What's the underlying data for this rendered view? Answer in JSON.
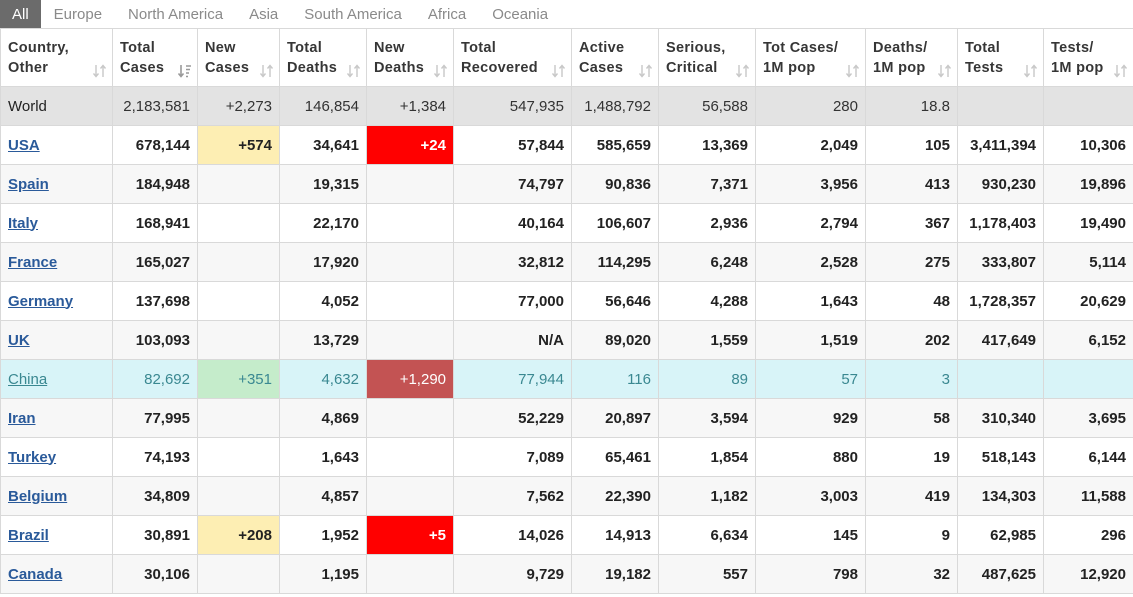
{
  "tabs": [
    "All",
    "Europe",
    "North America",
    "Asia",
    "South America",
    "Africa",
    "Oceania"
  ],
  "active_tab": "All",
  "headers": [
    [
      "Country,",
      "Other"
    ],
    [
      "Total",
      "Cases"
    ],
    [
      "New",
      "Cases"
    ],
    [
      "Total",
      "Deaths"
    ],
    [
      "New",
      "Deaths"
    ],
    [
      "Total",
      "Recovered"
    ],
    [
      "Active",
      "Cases"
    ],
    [
      "Serious,",
      "Critical"
    ],
    [
      "Tot Cases/",
      "1M pop"
    ],
    [
      "Deaths/",
      "1M pop"
    ],
    [
      "Total",
      "Tests"
    ],
    [
      "Tests/",
      "1M pop"
    ]
  ],
  "sorted_column": 1,
  "rows": [
    {
      "type": "world",
      "cells": [
        "World",
        "2,183,581",
        "+2,273",
        "146,854",
        "+1,384",
        "547,935",
        "1,488,792",
        "56,588",
        "280",
        "18.8",
        "",
        ""
      ]
    },
    {
      "type": "country",
      "cells": [
        "USA",
        "678,144",
        "+574",
        "34,641",
        "+24",
        "57,844",
        "585,659",
        "13,369",
        "2,049",
        "105",
        "3,411,394",
        "10,306"
      ]
    },
    {
      "type": "country",
      "cells": [
        "Spain",
        "184,948",
        "",
        "19,315",
        "",
        "74,797",
        "90,836",
        "7,371",
        "3,956",
        "413",
        "930,230",
        "19,896"
      ]
    },
    {
      "type": "country",
      "cells": [
        "Italy",
        "168,941",
        "",
        "22,170",
        "",
        "40,164",
        "106,607",
        "2,936",
        "2,794",
        "367",
        "1,178,403",
        "19,490"
      ]
    },
    {
      "type": "country",
      "cells": [
        "France",
        "165,027",
        "",
        "17,920",
        "",
        "32,812",
        "114,295",
        "6,248",
        "2,528",
        "275",
        "333,807",
        "5,114"
      ]
    },
    {
      "type": "country",
      "cells": [
        "Germany",
        "137,698",
        "",
        "4,052",
        "",
        "77,000",
        "56,646",
        "4,288",
        "1,643",
        "48",
        "1,728,357",
        "20,629"
      ]
    },
    {
      "type": "country",
      "cells": [
        "UK",
        "103,093",
        "",
        "13,729",
        "",
        "N/A",
        "89,020",
        "1,559",
        "1,519",
        "202",
        "417,649",
        "6,152"
      ]
    },
    {
      "type": "china",
      "cells": [
        "China",
        "82,692",
        "+351",
        "4,632",
        "+1,290",
        "77,944",
        "116",
        "89",
        "57",
        "3",
        "",
        ""
      ]
    },
    {
      "type": "country",
      "cells": [
        "Iran",
        "77,995",
        "",
        "4,869",
        "",
        "52,229",
        "20,897",
        "3,594",
        "929",
        "58",
        "310,340",
        "3,695"
      ]
    },
    {
      "type": "country",
      "cells": [
        "Turkey",
        "74,193",
        "",
        "1,643",
        "",
        "7,089",
        "65,461",
        "1,854",
        "880",
        "19",
        "518,143",
        "6,144"
      ]
    },
    {
      "type": "country",
      "cells": [
        "Belgium",
        "34,809",
        "",
        "4,857",
        "",
        "7,562",
        "22,390",
        "1,182",
        "3,003",
        "419",
        "134,303",
        "11,588"
      ]
    },
    {
      "type": "country",
      "cells": [
        "Brazil",
        "30,891",
        "+208",
        "1,952",
        "+5",
        "14,026",
        "14,913",
        "6,634",
        "145",
        "9",
        "62,985",
        "296"
      ]
    },
    {
      "type": "country",
      "cells": [
        "Canada",
        "30,106",
        "",
        "1,195",
        "",
        "9,729",
        "19,182",
        "557",
        "798",
        "32",
        "487,625",
        "12,920"
      ]
    }
  ],
  "colors": {
    "new_cases_highlight": "#fdeeb3",
    "new_deaths_highlight": "#ff0000",
    "china_row": "#d8f4f8",
    "china_new_cases": "#c5eccb",
    "china_new_deaths": "#c35353",
    "world_row": "#e3e3e3",
    "link": "#2a5a9a",
    "active_tab": "#6b6b6b"
  },
  "icons": {
    "sort": "sort-arrows-icon",
    "sort_active": "sort-desc-icon"
  }
}
